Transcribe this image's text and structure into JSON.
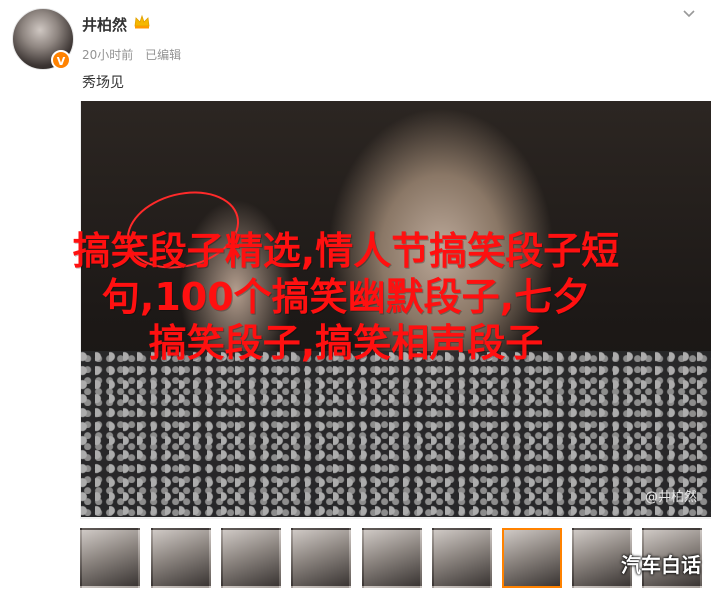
{
  "post": {
    "username": "井柏然",
    "time": "20小时前",
    "edited": "已编辑",
    "text": "秀场见",
    "verified_badge": "V",
    "crown_icon": "crown-icon",
    "menu_icon": "chevron-down-icon"
  },
  "image": {
    "watermark": "@井柏然",
    "overlay_lines": [
      "搞笑段子精选,情人节搞笑段子短",
      "句,100个搞笑幽默段子,七夕",
      "搞笑段子,搞笑相声段子"
    ],
    "overlay_color": "#ff1010"
  },
  "thumbnails": {
    "count": 9,
    "active_index": 6,
    "brand_text": "汽车白话",
    "active_color": "#ff8200"
  }
}
